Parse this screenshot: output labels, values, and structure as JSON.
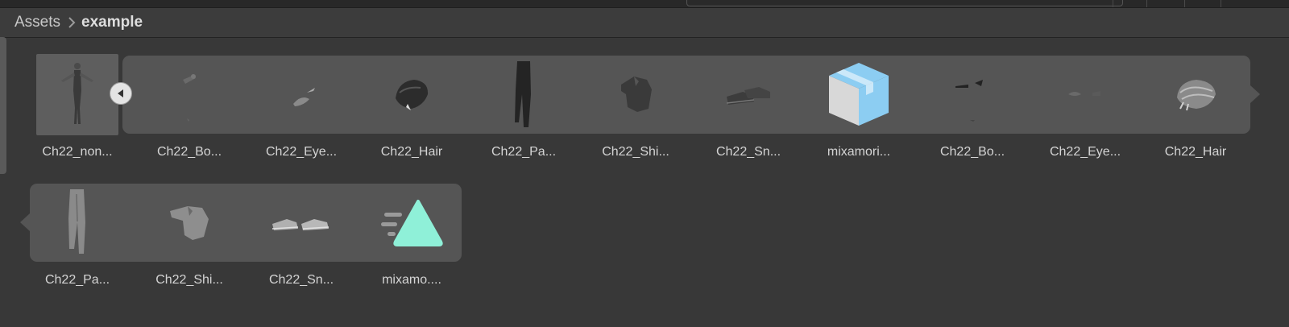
{
  "breadcrumb": {
    "root": "Assets",
    "current": "example"
  },
  "assets_row_1": [
    {
      "label": "Ch22_non...",
      "icon": "character-model-icon"
    },
    {
      "label": "Ch22_Bo...",
      "icon": "body-mesh-icon"
    },
    {
      "label": "Ch22_Eye...",
      "icon": "eyes-mesh-icon"
    },
    {
      "label": "Ch22_Hair",
      "icon": "hair-mesh-icon"
    },
    {
      "label": "Ch22_Pa...",
      "icon": "pants-mesh-icon"
    },
    {
      "label": "Ch22_Shi...",
      "icon": "shirt-mesh-icon"
    },
    {
      "label": "Ch22_Sn...",
      "icon": "sneakers-mesh-icon"
    },
    {
      "label": "mixamori...",
      "icon": "prefab-cube-icon"
    },
    {
      "label": "Ch22_Bo...",
      "icon": "body-material-icon"
    },
    {
      "label": "Ch22_Eye...",
      "icon": "eyes-material-icon"
    },
    {
      "label": "Ch22_Hair",
      "icon": "hair-material-icon"
    }
  ],
  "assets_row_2": [
    {
      "label": "Ch22_Pa...",
      "icon": "pants-material-icon"
    },
    {
      "label": "Ch22_Shi...",
      "icon": "shirt-material-icon"
    },
    {
      "label": "Ch22_Sn...",
      "icon": "sneakers-material-icon"
    },
    {
      "label": "mixamo....",
      "icon": "avatar-triangle-icon"
    }
  ],
  "colors": {
    "background": "#383838",
    "panel": "#555555",
    "prefab": "#8ccdf2",
    "avatar": "#8ff0d8"
  }
}
